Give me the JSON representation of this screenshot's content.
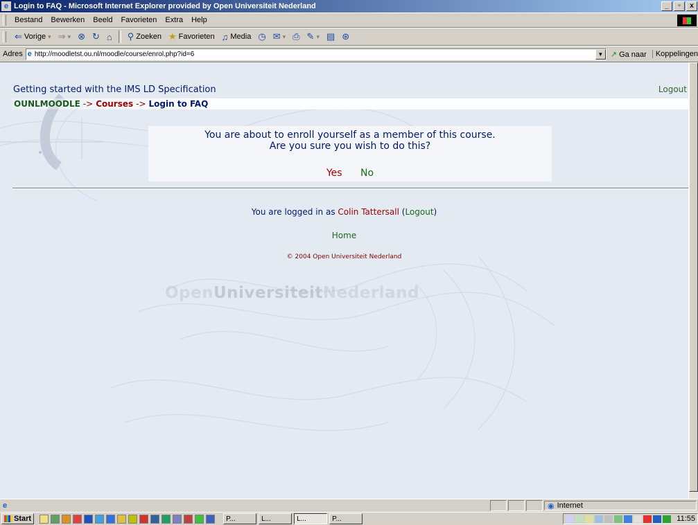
{
  "window": {
    "title": "Login to FAQ - Microsoft Internet Explorer provided by Open Universiteit Nederland",
    "minimize": "_",
    "maximize": "▫",
    "close": "x"
  },
  "menu": [
    "Bestand",
    "Bewerken",
    "Beeld",
    "Favorieten",
    "Extra",
    "Help"
  ],
  "toolbar": {
    "back": "Vorige",
    "search": "Zoeken",
    "favorites": "Favorieten",
    "media": "Media"
  },
  "address": {
    "label": "Adres",
    "url": "http://moodletst.ou.nl/moodle/course/enrol.php?id=6",
    "go": "Ga naar",
    "links": "Koppelingen"
  },
  "page": {
    "course_title": "Getting started with the IMS LD Specification",
    "logout": "Logout",
    "breadcrumb": {
      "home": "OUNLMOODLE",
      "sep": "->",
      "courses": "Courses",
      "current": "Login to FAQ"
    },
    "dialog": {
      "line1": "You are about to enroll yourself as a member of this course.",
      "line2": "Are you sure you wish to do this?",
      "yes": "Yes",
      "no": "No"
    },
    "login_info": {
      "prefix": "You are logged in as",
      "user": "Colin Tattersall",
      "logout": "Logout"
    },
    "home_link": "Home",
    "copyright": "© 2004 Open Universiteit Nederland",
    "watermark": {
      "part1": "Open",
      "part2": "Universiteit",
      "part3": "Nederland"
    }
  },
  "statusbar": {
    "zone": "Internet"
  },
  "taskbar": {
    "start": "Start",
    "tasks": [
      "P...",
      "L...",
      "L...",
      "P..."
    ],
    "clock": "11:55"
  }
}
